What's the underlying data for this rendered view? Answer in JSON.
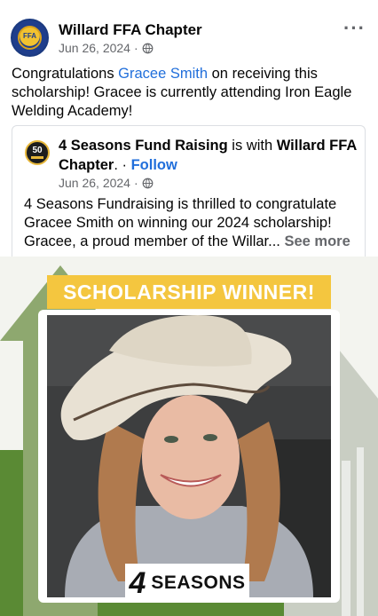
{
  "post": {
    "page_name": "Willard FFA Chapter",
    "date": "Jun 26, 2024",
    "separator": "·",
    "more_label": "···",
    "text_prefix": "Congratulations ",
    "mention": "Gracee Smith",
    "text_suffix": " on receiving this scholarship! Gracee is currently attending Iron Eagle Welding Academy!"
  },
  "shared_post": {
    "author": "4 Seasons Fund Raising",
    "with_text": " is with ",
    "with_page": "Willard FFA Chapter",
    "follow_sep": ". · ",
    "follow_label": "Follow",
    "date": "Jun 26, 2024",
    "separator": "·",
    "body": "4 Seasons Fundraising is thrilled to congratulate Gracee Smith on winning our 2024 scholarship! Gracee, a proud member of the Willar... ",
    "see_more": "See more",
    "avatar_text": "50"
  },
  "image": {
    "banner_text": "SCHOLARSHIP WINNER!",
    "logo_mark": "4",
    "logo_text": "SEASONS"
  },
  "colors": {
    "link": "#216fdb",
    "banner": "#f4c63f",
    "green": "#5a8a34"
  }
}
